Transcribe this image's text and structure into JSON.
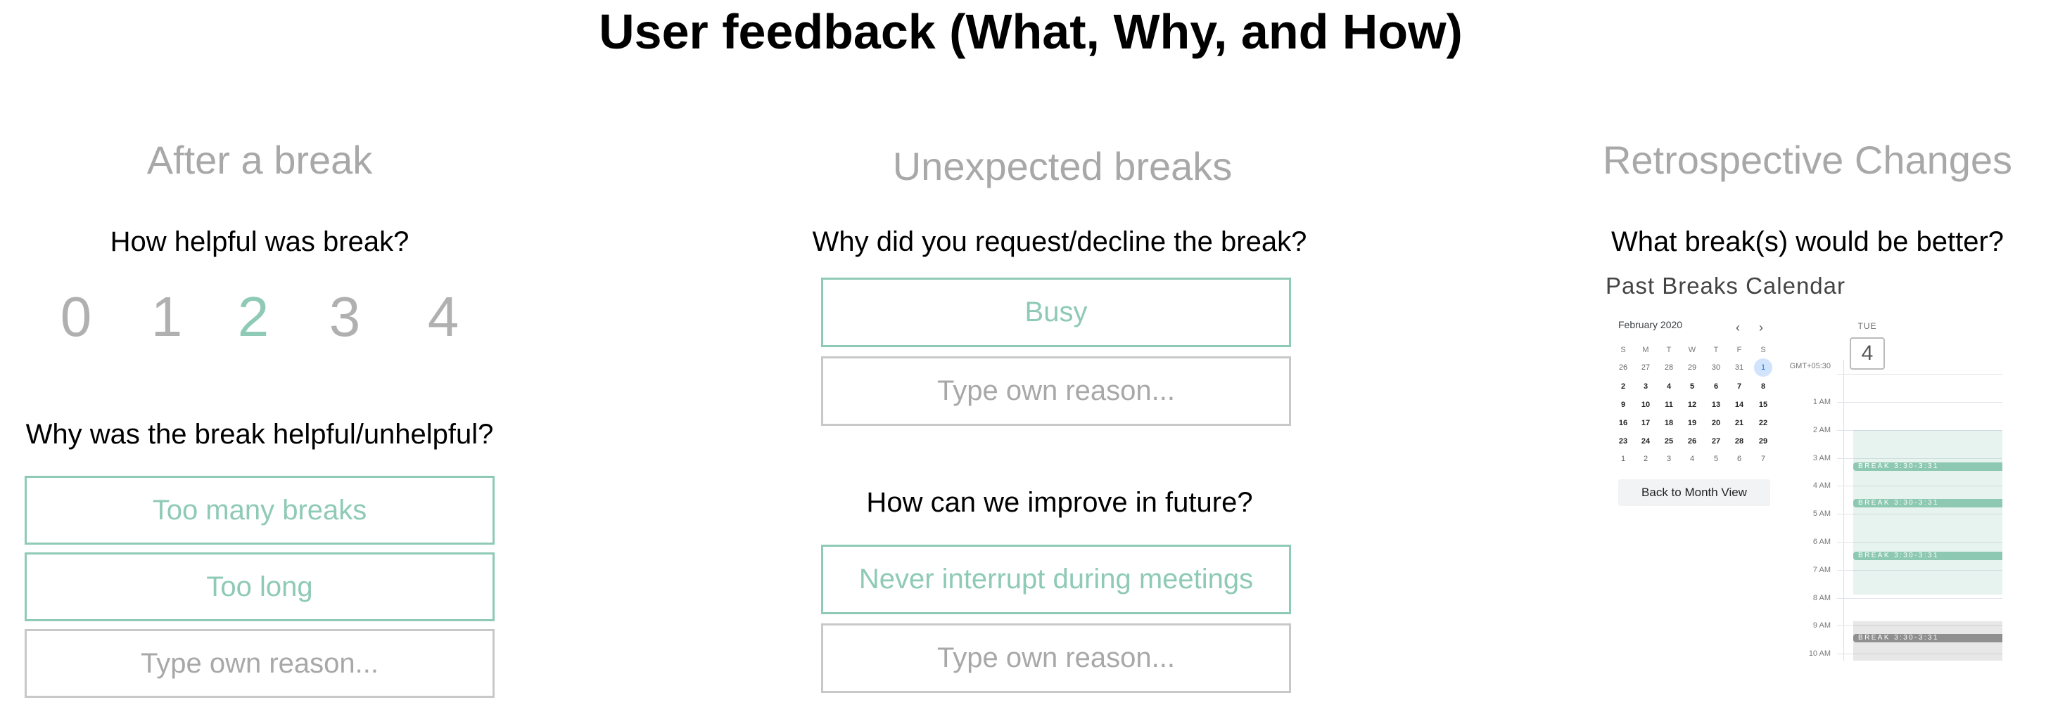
{
  "title": "User feedback (What, Why, and How)",
  "colors": {
    "accent": "#8ecab5",
    "muted": "#a8a8a8",
    "border": "#c8c8c8",
    "break_bar": "#8dc8b2",
    "past_bar": "#8f8f8f"
  },
  "after_break": {
    "heading": "After a break",
    "rating_question": "How helpful was break?",
    "rating_options": [
      "0",
      "1",
      "2",
      "3",
      "4"
    ],
    "rating_selected": 2,
    "reason_question": "Why was the break helpful/unhelpful?",
    "reasons": [
      {
        "label": "Too many breaks",
        "selected": true
      },
      {
        "label": "Too long",
        "selected": true
      },
      {
        "label": "Type own reason...",
        "selected": false
      }
    ]
  },
  "unexpected": {
    "heading": "Unexpected breaks",
    "why_question": "Why did you request/decline the break?",
    "why_options": [
      {
        "label": "Busy",
        "selected": true
      },
      {
        "label": "Type own reason...",
        "selected": false
      }
    ],
    "improve_question": "How can we improve in future?",
    "improve_options": [
      {
        "label": "Never interrupt during meetings",
        "selected": true
      },
      {
        "label": "Type own reason...",
        "selected": false
      }
    ]
  },
  "retro": {
    "heading": "Retrospective Changes",
    "question": "What break(s) would be better?",
    "calendar_title": "Past Breaks Calendar",
    "mini_calendar": {
      "month": "February 2020",
      "prev_icon": "chevron-left-icon",
      "next_icon": "chevron-right-icon",
      "weekdays": [
        "S",
        "M",
        "T",
        "W",
        "T",
        "F",
        "S"
      ],
      "weeks": [
        [
          "26",
          "27",
          "28",
          "29",
          "30",
          "31",
          "1"
        ],
        [
          "2",
          "3",
          "4",
          "5",
          "6",
          "7",
          "8"
        ],
        [
          "9",
          "10",
          "11",
          "12",
          "13",
          "14",
          "15"
        ],
        [
          "16",
          "17",
          "18",
          "19",
          "20",
          "21",
          "22"
        ],
        [
          "23",
          "24",
          "25",
          "26",
          "27",
          "28",
          "29"
        ],
        [
          "1",
          "2",
          "3",
          "4",
          "5",
          "6",
          "7"
        ]
      ],
      "selected_date": "1",
      "back_button": "Back to Month View"
    },
    "day_view": {
      "weekday": "TUE",
      "day": "4",
      "timezone": "GMT+05:30",
      "hours": [
        "1 AM",
        "2 AM",
        "3 AM",
        "4 AM",
        "5 AM",
        "6 AM",
        "7 AM",
        "8 AM",
        "9 AM",
        "10 AM"
      ],
      "breaks": [
        {
          "label": "BREAK  3:30-3:31",
          "past": false
        },
        {
          "label": "BREAK  3:30-3:31",
          "past": false
        },
        {
          "label": "BREAK  3:30-3:31",
          "past": false
        },
        {
          "label": "BREAK  3:30-3:31",
          "past": true
        }
      ]
    }
  }
}
